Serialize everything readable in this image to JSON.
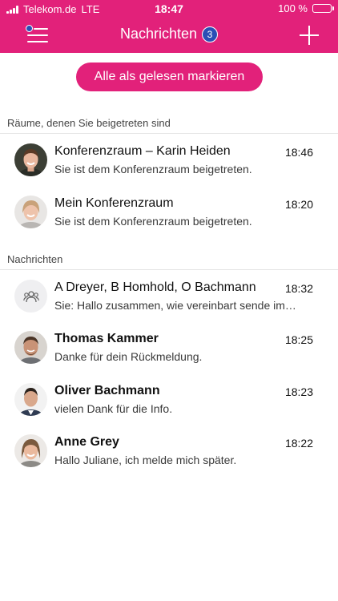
{
  "status_bar": {
    "carrier": "Telekom.de",
    "network": "LTE",
    "time": "18:47",
    "battery": "100 %",
    "battery_level": 1.0
  },
  "nav": {
    "title": "Nachrichten",
    "unread_count": "3",
    "menu_icon": "menu-icon",
    "add_icon": "plus-icon"
  },
  "mark_all_read_label": "Alle als gelesen markieren",
  "rooms": {
    "header": "Räume, denen Sie beigetreten sind",
    "items": [
      {
        "title": "Konferenzraum – Karin Heiden",
        "subtitle": "Sie ist dem Konferenzraum beigetreten.",
        "time": "18:46"
      },
      {
        "title": "Mein Konferenzraum",
        "subtitle": "Sie ist dem Konferenzraum beigetreten.",
        "time": "18:20"
      }
    ]
  },
  "messages": {
    "header": "Nachrichten",
    "items": [
      {
        "title": "A Dreyer, B Homhold, O Bachmann",
        "subtitle": "Sie: Hallo zusammen, wie vereinbart sende im…",
        "time": "18:32"
      },
      {
        "title": "Thomas Kammer",
        "subtitle": "Danke für dein Rückmeldung.",
        "time": "18:25"
      },
      {
        "title": "Oliver Bachmann",
        "subtitle": "vielen Dank für die Info.",
        "time": "18:23"
      },
      {
        "title": "Anne Grey",
        "subtitle": "Hallo Juliane, ich melde mich später.",
        "time": "18:22"
      }
    ]
  },
  "colors": {
    "brand": "#e2217a",
    "badge": "#2a4fb5"
  }
}
